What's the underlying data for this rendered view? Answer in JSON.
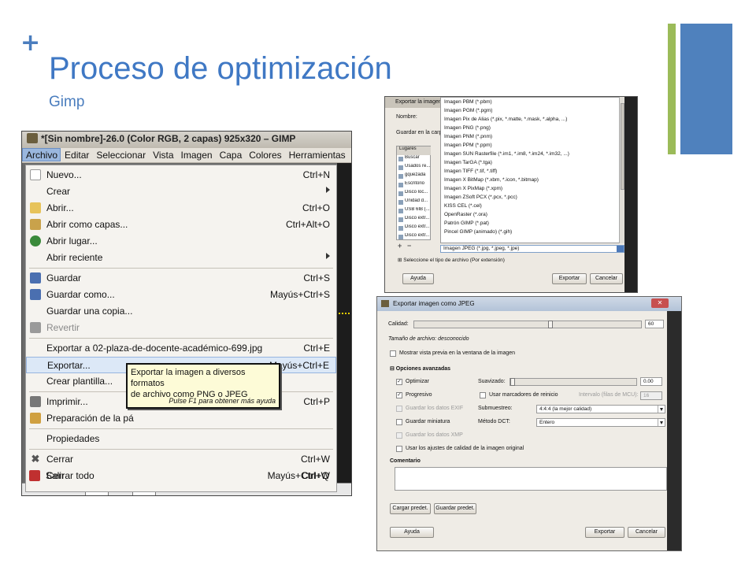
{
  "slide": {
    "plus": "+",
    "title": "Proceso de optimización",
    "subtitle": "Gimp"
  },
  "gimp": {
    "window_title": "*[Sin nombre]-26.0 (Color RGB, 2 capas) 925x320 – GIMP",
    "menubar": [
      "Archivo",
      "Editar",
      "Seleccionar",
      "Vista",
      "Imagen",
      "Capa",
      "Colores",
      "Herramientas"
    ],
    "menu": [
      {
        "label": "Nuevo...",
        "shortcut": "Ctrl+N"
      },
      {
        "label": "Crear",
        "submenu": true
      },
      {
        "label": "Abrir...",
        "shortcut": "Ctrl+O"
      },
      {
        "label": "Abrir como capas...",
        "shortcut": "Ctrl+Alt+O"
      },
      {
        "label": "Abrir lugar...",
        "shortcut": ""
      },
      {
        "label": "Abrir reciente",
        "submenu": true
      },
      {
        "label": "Guardar",
        "shortcut": "Ctrl+S"
      },
      {
        "label": "Guardar como...",
        "shortcut": "Mayús+Ctrl+S"
      },
      {
        "label": "Guardar una copia...",
        "shortcut": ""
      },
      {
        "label": "Revertir",
        "shortcut": "",
        "disabled": true
      },
      {
        "label": "Exportar a 02-plaza-de-docente-académico-699.jpg",
        "shortcut": "Ctrl+E"
      },
      {
        "label": "Exportar...",
        "shortcut": "Mayús+Ctrl+E",
        "highlighted": true
      },
      {
        "label": "Crear plantilla...",
        "shortcut": ""
      },
      {
        "label": "Imprimir...",
        "shortcut": "Ctrl+P"
      },
      {
        "label": "Preparación de la pá",
        "shortcut": ""
      },
      {
        "label": "Propiedades",
        "shortcut": ""
      },
      {
        "label": "Cerrar",
        "shortcut": "Ctrl+W"
      },
      {
        "label": "Cerrar todo",
        "shortcut": "Mayús+Ctrl+W"
      },
      {
        "label": "Salir",
        "shortcut": "Ctrl+Q"
      }
    ],
    "tooltip": {
      "line1": "Exportar la imagen a diversos formatos",
      "line2": "de archivo como PNG o JPEG",
      "hint": "Pulse F1 para obtener más ayuda"
    }
  },
  "export_dialog": {
    "title": "Exportar la imagen",
    "name_label": "Nombre:",
    "folder_label": "Guardar en la carpeta",
    "places": [
      "Lugares",
      "Buscar",
      "Usados re...",
      "gquezada",
      "Escritorio",
      "Disco loc...",
      "Unidad d...",
      "USB 6IB (...",
      "Disco extr...",
      "Disco extr...",
      "Disco extr..."
    ],
    "file_types": [
      "Imagen PBM (*.pbm)",
      "Imagen PGM (*.pgm)",
      "Imagen Pix de Alias (*.pix, *.matte, *.mask, *.alpha, ...)",
      "Imagen PNG (*.png)",
      "Imagen PNM (*.pnm)",
      "Imagen PPM (*.ppm)",
      "Imagen SUN Rasterfile (*.im1, *.im8, *.im24, *.im32, ...)",
      "Imagen TarGA (*.tga)",
      "Imagen TIFF (*.tif, *.tiff)",
      "Imagen X BitMap (*.xbm, *.icon, *.bitmap)",
      "Imagen X PixMap (*.xpm)",
      "Imagen ZSoft PCX (*.pcx, *.pcc)",
      "KISS CEL (*.cel)",
      "OpenRaster (*.ora)",
      "Patrón GIMP (*.pat)",
      "Pincel GIMP (animado) (*.gih)"
    ],
    "selected_type": "Imagen JPEG (*.jpg, *.jpeg, *.jpe)",
    "add": "+",
    "remove": "−",
    "expander": "⊞ Seleccione el tipo de archivo (Por extensión)",
    "help": "Ayuda",
    "export": "Exportar",
    "cancel": "Cancelar"
  },
  "jpeg_dialog": {
    "title": "Exportar imagen como JPEG",
    "close": "✕",
    "quality_label": "Calidad:",
    "quality_value": "60",
    "quality_fraction": 0.6,
    "filesize": "Tamaño de archivo: desconocido",
    "preview": "Mostrar vista previa en la ventana de la imagen",
    "advanced": "⊟ Opciones avanzadas",
    "optimize": "Optimizar",
    "smoothing_label": "Suavizado:",
    "smoothing_value": "0.00",
    "progressive": "Progresivo",
    "restart": "Usar marcadores de reinicio",
    "interval_label": "Intervalo (filas de MCU):",
    "interval_value": "16",
    "exif": "Guardar los datos EXIF",
    "subsampling_label": "Submuestreo:",
    "subsampling_value": "4:4:4 (la mejor calidad)",
    "thumbnail": "Guardar miniatura",
    "dct_label": "Método DCT:",
    "dct_value": "Entero",
    "xmp": "Guardar los datos XMP",
    "use_quality": "Usar los ajustes de calidad de la imagen original",
    "comment_label": "Comentario",
    "load_defaults": "Cargar predet.",
    "save_defaults": "Guardar predet.",
    "help": "Ayuda",
    "export": "Exportar",
    "cancel": "Cancelar",
    "check": "✓"
  },
  "colors": {
    "title": "#3f78c4",
    "accent_green": "#9bbb59",
    "accent_blue": "#4f81bd"
  }
}
